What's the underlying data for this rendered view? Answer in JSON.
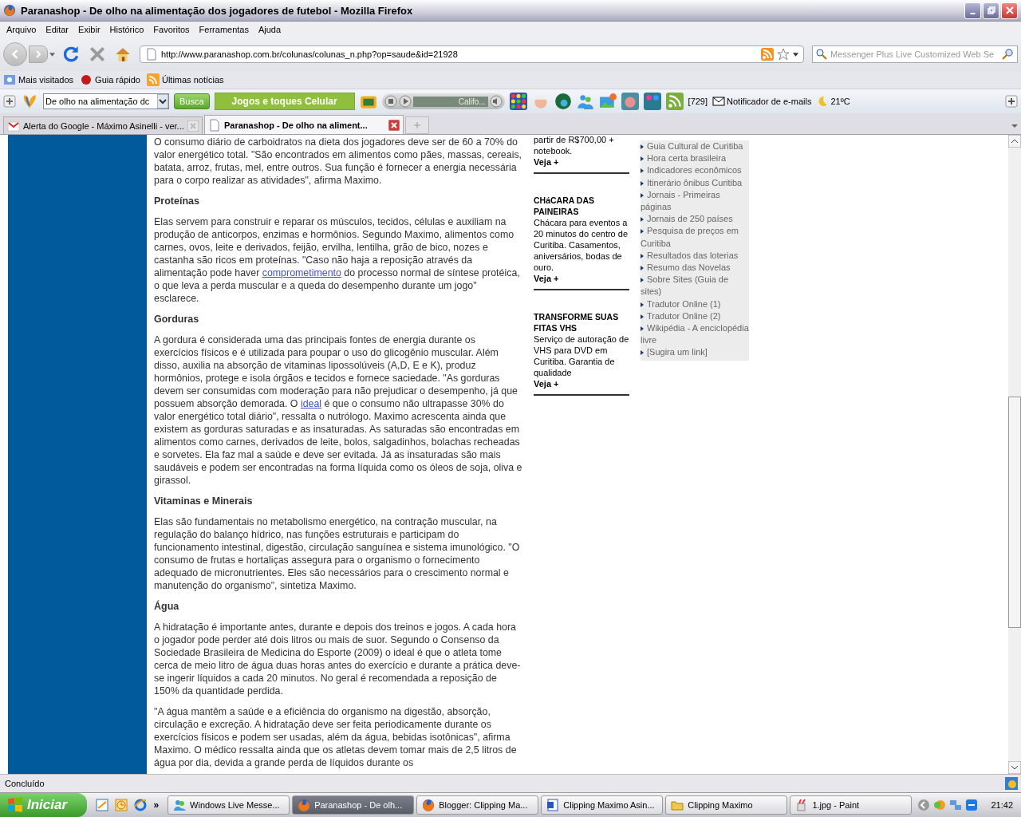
{
  "window": {
    "title": "Paranashop - De olho na alimentação dos jogadores de futebol - Mozilla Firefox"
  },
  "menu": [
    "Arquivo",
    "Editar",
    "Exibir",
    "Histórico",
    "Favoritos",
    "Ferramentas",
    "Ajuda"
  ],
  "address_bar": {
    "value": "http://www.paranashop.com.br/colunas/colunas_n.php?op=saude&id=21928"
  },
  "web_search": {
    "placeholder": "Messenger Plus Live Customized Web Se"
  },
  "bookmarks": [
    "Mais visitados",
    "Guia rápido",
    "Últimas notícias"
  ],
  "addon_toolbar": {
    "search_value": "De olho na alimentação dc",
    "search_button": "Busca",
    "promo": "Jogos e toques Celular",
    "player_track": "Califo...",
    "count": "[729]",
    "mail": "Notificador de e-mails",
    "weather": "21ºC"
  },
  "tabs": [
    {
      "label": "Alerta do Google - Máximo Asinelli - ver...",
      "selected": false
    },
    {
      "label": "Paranashop - De olho na aliment...",
      "selected": true
    }
  ],
  "article": [
    {
      "kind": "paragraph",
      "parts": [
        {
          "kind": "text",
          "text": "O consumo diário de carboidratos na dieta dos jogadores deve ser de  60 a 70% do valor energético total. \"São encontrados em alimentos como pães, massas, cereais, batata, arroz, frutas, mel, entre outros. Sua função é fornecer a energia necessária para o corpo realizar as atividades\", afirma Maximo."
        }
      ]
    },
    {
      "kind": "heading",
      "text": "Proteínas"
    },
    {
      "kind": "paragraph",
      "parts": [
        {
          "kind": "text",
          "text": "Elas servem para construir e reparar os músculos, tecidos, células e auxiliam na produção de anticorpos, enzimas e hormônios. Segundo Maximo, alimentos como carnes, ovos, leite e derivados, feijão, ervilha, lentilha, grão de bico, nozes e castanha são ricos em proteínas. \"Caso não haja a reposição através da alimentação pode haver "
        },
        {
          "kind": "link",
          "text": "comprometimento"
        },
        {
          "kind": "text",
          "text": " do processo normal de síntese protéica, o que leva a perda muscular e a queda do desempenho durante um jogo\" esclarece."
        }
      ]
    },
    {
      "kind": "heading",
      "text": "Gorduras"
    },
    {
      "kind": "paragraph",
      "parts": [
        {
          "kind": "text",
          "text": "A gordura é considerada uma das principais fontes de energia durante os exercícios físicos e é utilizada para poupar o uso do glicogênio muscular. Além disso, auxilia na absorção de vitaminas lipossolúveis (A,D, E e K), produz hormônios, protege e isola órgãos e tecidos e fornece saciedade. \"As gorduras devem ser consumidas com moderação para não prejudicar o desempenho, já que possuem absorção demorada. O "
        },
        {
          "kind": "link",
          "text": "ideal"
        },
        {
          "kind": "text",
          "text": " é que o consumo não ultrapasse 30% do valor energético total diário\", ressalta o nutrólogo. Maximo acrescenta ainda que existem as gorduras saturadas e as insaturadas. As saturadas são encontradas em alimentos como carnes, derivados de leite, bolos, salgadinhos, bolachas recheadas e sorvetes. Ela faz mal a saúde e deve ser evitada. Já as insaturadas são mais saudáveis e podem ser encontradas na forma líquida como os óleos de soja, oliva e girassol."
        }
      ]
    },
    {
      "kind": "heading",
      "text": "Vitaminas e Minerais"
    },
    {
      "kind": "paragraph",
      "parts": [
        {
          "kind": "text",
          "text": "Elas são fundamentais no metabolismo energético, na contração muscular, na regulação do balanço hídrico, nas funções estruturais e participam do funcionamento intestinal, digestão, circulação sanguínea e sistema imunológico. \"O consumo de frutas e hortaliças assegura para o organismo o fornecimento adequado de micronutrientes. Eles são necessários para o crescimento normal e manutenção do organismo\", sintetiza Maximo."
        }
      ]
    },
    {
      "kind": "heading",
      "text": "Água"
    },
    {
      "kind": "paragraph",
      "parts": [
        {
          "kind": "text",
          "text": "A hidratação é importante antes, durante e depois dos treinos e jogos. A cada hora o jogador pode perder até dois litros ou mais de suor. Segundo o Consenso da Sociedade Brasileira de Medicina do Esporte (2009) o ideal é que o atleta tome cerca de meio litro de água duas horas antes do exercício e durante a prática deve-se ingerir líquidos a cada 20 minutos. No geral é recomendada a reposição de 150% da quantidade perdida."
        }
      ]
    },
    {
      "kind": "paragraph",
      "parts": [
        {
          "kind": "text",
          "text": "\"A água mantêm a saúde e a eficiência do organismo na digestão, absorção, circulação e excreção. A hidratação deve ser feita periodicamente durante os exercícios físicos e podem ser usadas, além da água, bebidas isotônicas\", afirma Maximo. O médico ressalta ainda que os atletas devem tomar mais de 2,5 litros de água por dia, devida a grande perda de líquidos durante os"
        }
      ]
    }
  ],
  "ads": [
    {
      "text": "partir de R$700,00 + notebook.",
      "more": "Veja +"
    },
    {
      "title": "CHáCARA DAS PAINEIRAS",
      "text": "Chácara para eventos a 20 minutos do centro de Curitiba. Casamentos, aniversários, bodas de ouro.",
      "more": "Veja +"
    },
    {
      "title": "TRANSFORME SUAS FITAS VHS",
      "text": "Serviço de autoração de VHS para DVD em Curitiba. Garantia de qualidade",
      "more": "Veja +"
    }
  ],
  "links": [
    "Guia Cultural de Curitiba",
    "Hora certa brasileira",
    "Indicadores econômicos",
    "Itinerário ônibus Curitiba",
    "Jornais - Primeiras páginas",
    "Jornais de 250 países",
    "Pesquisa de preços em Curitiba",
    "Resultados das loterias",
    "Resumo das Novelas",
    "Sobre Sites (Guia de sites)",
    "Tradutor Online (1)",
    "Tradutor Online (2)",
    "Wikipédia - A enciclopédia livre",
    "[Sugira um link]"
  ],
  "status_bar": "Concluído",
  "taskbar": {
    "start": "Iniciar",
    "overflow": "»",
    "buttons": [
      {
        "label": "Windows Live Messe...",
        "selected": false
      },
      {
        "label": "Paranashop - De olh...",
        "selected": true
      },
      {
        "label": "Blogger: Clipping Ma...",
        "selected": false
      },
      {
        "label": "Clipping Maximo Asin...",
        "selected": false
      },
      {
        "label": "Clipping Maximo",
        "selected": false
      },
      {
        "label": "1.jpg - Paint",
        "selected": false
      }
    ],
    "clock": "21:42"
  }
}
